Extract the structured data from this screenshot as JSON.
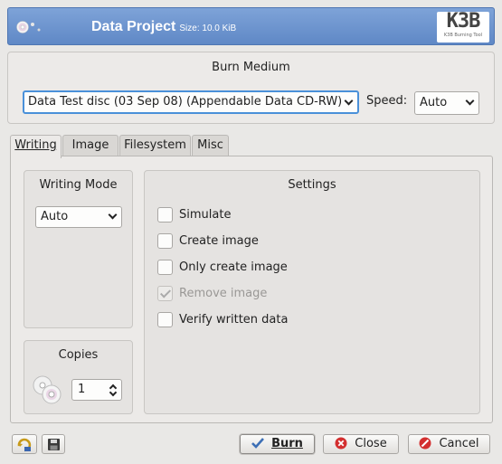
{
  "header": {
    "title": "Data Project",
    "subtitle": "Size: 10.0 KiB",
    "logo_text": "K3B",
    "logo_subtext": "K3B Burning Tool"
  },
  "burn_medium": {
    "title": "Burn Medium",
    "medium_selected": "Data Test disc (03 Sep 08) (Appendable Data CD-RW)",
    "speed_label": "Speed:",
    "speed_selected": "Auto"
  },
  "tabs": [
    {
      "label": "Writing",
      "active": true
    },
    {
      "label": "Image",
      "active": false
    },
    {
      "label": "Filesystem",
      "active": false
    },
    {
      "label": "Misc",
      "active": false
    }
  ],
  "writing_mode": {
    "title": "Writing Mode",
    "selected": "Auto"
  },
  "copies": {
    "title": "Copies",
    "value": "1"
  },
  "settings": {
    "title": "Settings",
    "options": [
      {
        "label": "Simulate",
        "checked": false,
        "enabled": true
      },
      {
        "label": "Create image",
        "checked": false,
        "enabled": true
      },
      {
        "label": "Only create image",
        "checked": false,
        "enabled": true
      },
      {
        "label": "Remove image",
        "checked": true,
        "enabled": false
      },
      {
        "label": "Verify written data",
        "checked": false,
        "enabled": true
      }
    ]
  },
  "buttons": {
    "burn": "Burn",
    "close": "Close",
    "cancel": "Cancel"
  },
  "icons": {
    "load": "load-settings-icon",
    "save": "save-icon",
    "burn": "checkmark-icon",
    "close": "close-icon",
    "cancel": "cancel-icon"
  },
  "colors": {
    "banner": "#6a91cc",
    "focus": "#4a90d9",
    "close_red": "#d32f2f"
  }
}
